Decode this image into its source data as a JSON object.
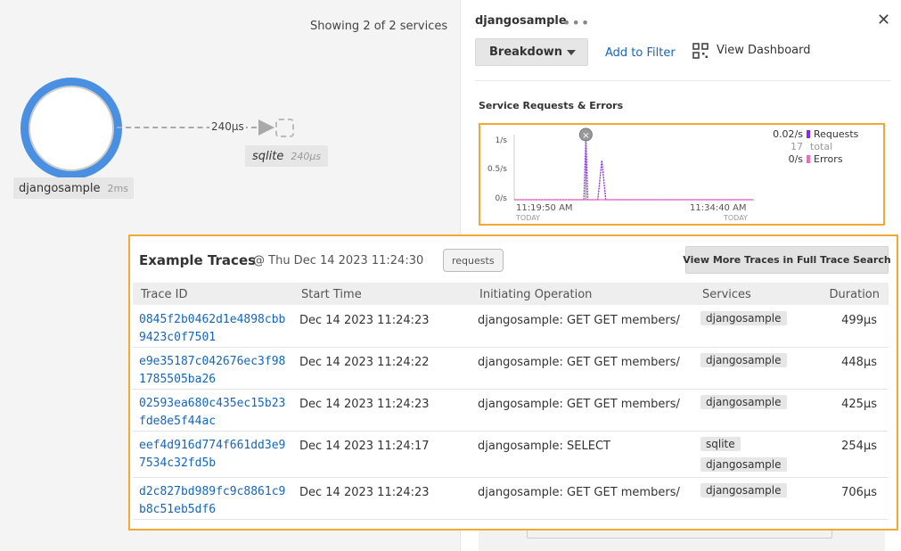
{
  "map": {
    "showing_text": "Showing 2 of 2 services",
    "edge_latency": "240µs",
    "main_node": {
      "name": "djangosample",
      "latency": "2ms",
      "color": "#4a90e2"
    },
    "sqlite_node": {
      "name": "sqlite",
      "latency": "240µs"
    }
  },
  "panel": {
    "title": "djangosample",
    "more_icon": "more-horizontal-icon",
    "close_icon": "close-icon",
    "breakdown_label": "Breakdown",
    "add_filter_label": "Add to Filter",
    "view_dashboard_label": "View Dashboard",
    "section_title": "Service Requests & Errors",
    "legend": {
      "requests_rate": "0.02",
      "requests_unit": "/s",
      "requests_label": "Requests",
      "requests_total": "17",
      "requests_total_label": "total",
      "errors_rate": "0",
      "errors_unit": "/s",
      "errors_label": "Errors"
    },
    "requests_color": "#8a2be2",
    "errors_color": "#f06ac4",
    "accent_color": "#f0a836",
    "link_color": "#1565c0"
  },
  "chart_data": {
    "type": "line",
    "title": "Service Requests & Errors",
    "y_ticks": [
      "1/s",
      "0.5/s",
      "0/s"
    ],
    "ylim": [
      0,
      1
    ],
    "x_ticks": [
      "11:19:50 AM",
      "11:34:40 AM"
    ],
    "x_subticks": [
      "TODAY",
      "TODAY"
    ],
    "x_range": [
      "11:18:30 AM",
      "11:38:30 AM"
    ],
    "series": [
      {
        "name": "Requests",
        "color": "#8a2be2",
        "x": [
          "11:18:30 AM",
          "11:24:00 AM",
          "11:24:20 AM",
          "11:24:30 AM",
          "11:24:40 AM",
          "11:25:00 AM",
          "11:25:30 AM",
          "11:25:50 AM",
          "11:26:10 AM",
          "11:38:30 AM"
        ],
        "values": [
          0,
          0,
          0,
          1.0,
          0,
          0,
          0,
          0.62,
          0,
          0
        ]
      },
      {
        "name": "Errors",
        "color": "#f06ac4",
        "x": [
          "11:18:30 AM",
          "11:38:30 AM"
        ],
        "values": [
          0,
          0
        ]
      }
    ],
    "grid": false,
    "legend_position": "right"
  },
  "traces": {
    "title": "Example Traces",
    "at_label": "@ Thu Dec 14 2023 11:24:30",
    "badge": "requests",
    "view_more_label": "View More Traces in Full Trace Search",
    "columns": [
      "Trace ID",
      "Start Time",
      "Initiating Operation",
      "Services",
      "Duration"
    ],
    "rows": [
      {
        "trace_id": "0845f2b0462d1e4898cbb9423c0f7501",
        "start": "Dec 14 2023 11:24:23",
        "operation": "djangosample: GET GET members/",
        "services": [
          "djangosample"
        ],
        "duration": "499µs"
      },
      {
        "trace_id": "e9e35187c042676ec3f981785505ba26",
        "start": "Dec 14 2023 11:24:22",
        "operation": "djangosample: GET GET members/",
        "services": [
          "djangosample"
        ],
        "duration": "448µs"
      },
      {
        "trace_id": "02593ea680c435ec15b23fde8e5f44ac",
        "start": "Dec 14 2023 11:24:23",
        "operation": "djangosample: GET GET members/",
        "services": [
          "djangosample"
        ],
        "duration": "425µs"
      },
      {
        "trace_id": "eef4d916d774f661dd3e97534c32fd5b",
        "start": "Dec 14 2023 11:24:17",
        "operation": "djangosample: SELECT",
        "services": [
          "sqlite",
          "djangosample"
        ],
        "duration": "254µs"
      },
      {
        "trace_id": "d2c827bd989fc9c8861c9b8c51eb5df6",
        "start": "Dec 14 2023 11:24:23",
        "operation": "djangosample: GET GET members/",
        "services": [
          "djangosample"
        ],
        "duration": "706µs"
      }
    ]
  }
}
